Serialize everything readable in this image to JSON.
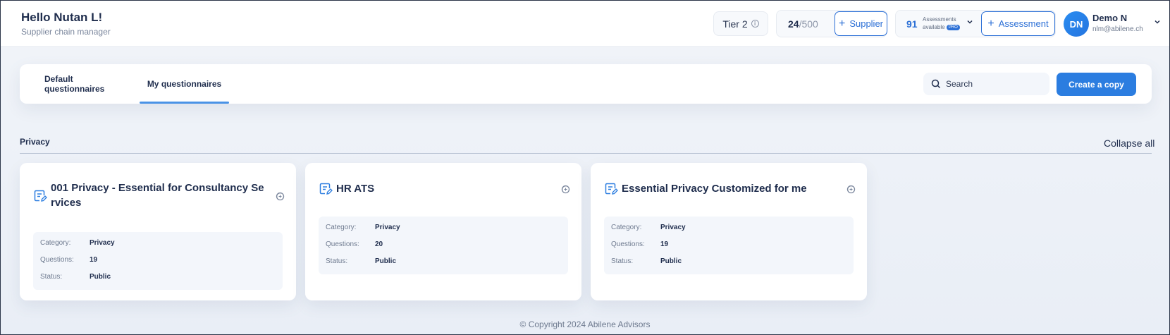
{
  "header": {
    "greeting": "Hello Nutan L!",
    "role": "Supplier chain manager",
    "tier_label": "Tier 2",
    "suppliers_used": "24",
    "suppliers_total": "/500",
    "supplier_button": "Supplier",
    "assessments_count": "91",
    "assessments_label_1": "Assessments",
    "assessments_label_2": "available",
    "pro_badge": "PRO",
    "assessment_button": "Assessment",
    "user_initials": "DN",
    "user_name": "Demo N",
    "user_email": "nlm@abilene.ch"
  },
  "tabs": [
    {
      "label": "Default questionnaires",
      "active": false
    },
    {
      "label": "My questionnaires",
      "active": true
    }
  ],
  "search": {
    "placeholder": "Search"
  },
  "create_copy_label": "Create a copy",
  "section": {
    "title": "Privacy",
    "collapse_label": "Collapse all"
  },
  "detail_labels": {
    "category": "Category:",
    "questions": "Questions:",
    "status": "Status:"
  },
  "cards": [
    {
      "title": "001 Privacy - Essential for Consultancy Services",
      "category": "Privacy",
      "questions": "19",
      "status": "Public"
    },
    {
      "title": "HR ATS",
      "category": "Privacy",
      "questions": "20",
      "status": "Public"
    },
    {
      "title": "Essential Privacy Customized for me",
      "category": "Privacy",
      "questions": "19",
      "status": "Public"
    }
  ],
  "footer": "© Copyright 2024 Abilene Advisors",
  "colors": {
    "accent": "#2b7de0",
    "text": "#1f2d4d"
  }
}
